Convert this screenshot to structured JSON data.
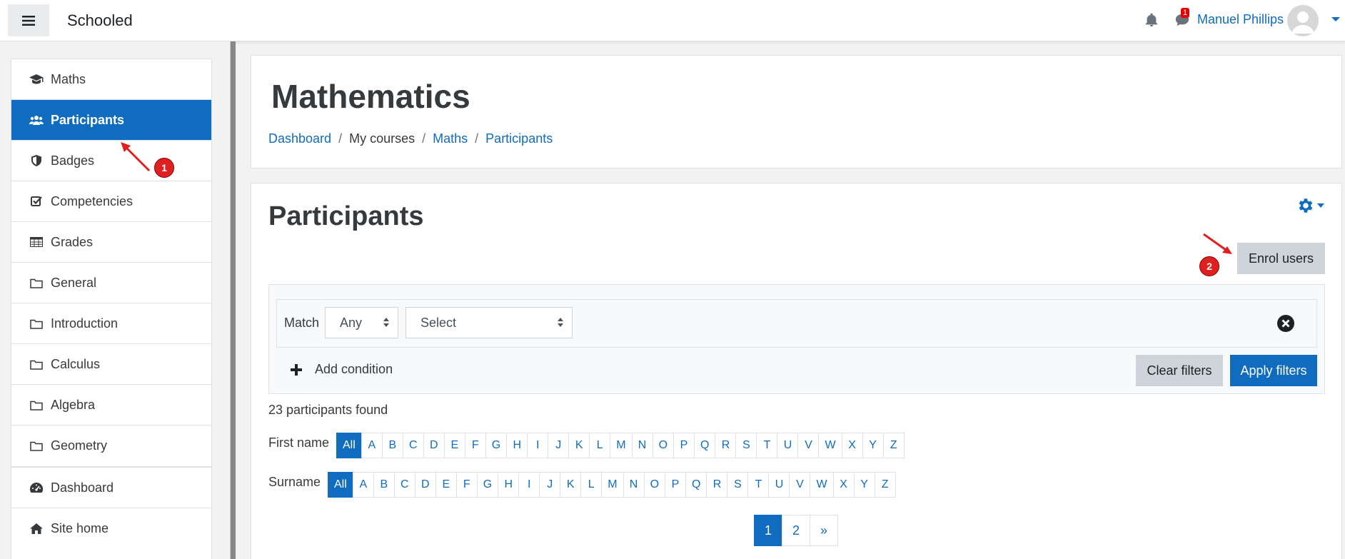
{
  "navbar": {
    "brand": "Schooled",
    "user_name": "Manuel Phillips",
    "message_count": "1",
    "icons": [
      "hamburger-icon",
      "bell-icon",
      "message-icon",
      "avatar",
      "chevron-down-icon"
    ]
  },
  "drawer": {
    "course_items": [
      {
        "label": "Maths",
        "icon": "graduation-cap-icon"
      },
      {
        "label": "Participants",
        "icon": "users-icon",
        "active": true
      },
      {
        "label": "Badges",
        "icon": "shield-icon"
      },
      {
        "label": "Competencies",
        "icon": "checkbox-icon"
      },
      {
        "label": "Grades",
        "icon": "table-icon"
      },
      {
        "label": "General",
        "icon": "folder-icon"
      },
      {
        "label": "Introduction",
        "icon": "folder-icon"
      },
      {
        "label": "Calculus",
        "icon": "folder-icon"
      },
      {
        "label": "Algebra",
        "icon": "folder-icon"
      },
      {
        "label": "Geometry",
        "icon": "folder-icon"
      }
    ],
    "site_items": [
      {
        "label": "Dashboard",
        "icon": "dashboard-icon"
      },
      {
        "label": "Site home",
        "icon": "home-icon"
      }
    ]
  },
  "header": {
    "title": "Mathematics",
    "breadcrumb": [
      "Dashboard",
      "My courses",
      "Maths",
      "Participants"
    ]
  },
  "participants": {
    "title": "Participants",
    "enrol_label": "Enrol users",
    "filter": {
      "match_label": "Match",
      "match_value": "Any",
      "select_value": "Select",
      "add_condition": "Add condition",
      "clear_label": "Clear filters",
      "apply_label": "Apply filters"
    },
    "found_text": "23 participants found",
    "firstname_label": "First name",
    "surname_label": "Surname",
    "all_label": "All",
    "letters": [
      "A",
      "B",
      "C",
      "D",
      "E",
      "F",
      "G",
      "H",
      "I",
      "J",
      "K",
      "L",
      "M",
      "N",
      "O",
      "P",
      "Q",
      "R",
      "S",
      "T",
      "U",
      "V",
      "W",
      "X",
      "Y",
      "Z"
    ],
    "pages": [
      "1",
      "2",
      "»"
    ]
  },
  "annotations": {
    "step1": "1",
    "step2": "2"
  },
  "colors": {
    "accent": "#0f6cbf",
    "annotation": "#e02020"
  }
}
